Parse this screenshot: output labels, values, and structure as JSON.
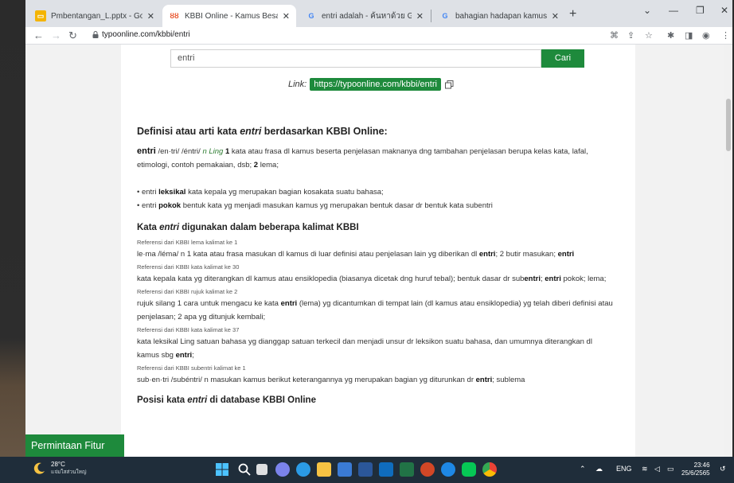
{
  "tabs": [
    {
      "title": "Pmbentangan_L.pptx - Google s",
      "active": false,
      "favicon_color": "#f4b400",
      "favicon_glyph": "▭"
    },
    {
      "title": "KBBI Online - Kamus Besar Baha",
      "active": true,
      "favicon_color": "#e8552d",
      "favicon_glyph": "ȣȣ"
    },
    {
      "title": "entri adalah - ค้นหาด้วย Google",
      "active": false,
      "favicon_color": "#4285f4",
      "favicon_glyph": "G"
    },
    {
      "title": "bahagian hadapan kamus dewan",
      "active": false,
      "favicon_color": "#4285f4",
      "favicon_glyph": "G"
    }
  ],
  "address": {
    "url": "typoonline.com/kbbi/entri"
  },
  "search": {
    "value": "entri",
    "button_label": "Cari"
  },
  "link": {
    "label": "Link:",
    "url": "https://typoonline.com/kbbi/entri"
  },
  "definition": {
    "heading_pre": "Definisi atau arti kata ",
    "heading_word": "entri",
    "heading_post": " berdasarkan KBBI Online:",
    "entry_word": "entri",
    "entry_pron": " /en·tri/ /éntri/ ",
    "entry_class": "n Ling",
    "entry_num1": " 1",
    "entry_text1": " kata atau frasa dl kamus beserta penjelasan maknanya dng tambahan penjelasan berupa kelas kata, lafal, etimologi, contoh pemakaian, dsb;",
    "entry_num2": " 2",
    "entry_text2": " lema;",
    "bullet1_pre": "• entri ",
    "bullet1_bold": "leksikal",
    "bullet1_post": " kata kepala yg merupakan bagian kosakata suatu bahasa;",
    "bullet2_pre": "• entri ",
    "bullet2_bold": "pokok",
    "bullet2_post": " bentuk kata yg menjadi masukan kamus yg merupakan bentuk dasar dr bentuk kata subentri"
  },
  "usage": {
    "heading_pre": "Kata ",
    "heading_word": "entri",
    "heading_post": " digunakan dalam beberapa kalimat KBBI",
    "items": [
      {
        "ref": "Referensi dari KBBI lema kalimat ke 1",
        "pre": "le·ma /léma/ n 1 kata atau frasa masukan dl kamus di luar definisi atau penjelasan lain yg diberikan dl ",
        "bold": "entri",
        "post": "; 2 butir masukan; ",
        "bold2": "entri",
        "post2": ""
      },
      {
        "ref": "Referensi dari KBBI kata kalimat ke 30",
        "pre": "kata kepala kata yg diterangkan dl kamus atau ensiklopedia (biasanya dicetak dng huruf tebal); bentuk dasar dr sub",
        "bold": "entri",
        "post": "; ",
        "bold2": "entri",
        "post2": " pokok; lema;"
      },
      {
        "ref": "Referensi dari KBBI rujuk kalimat ke 2",
        "pre": "rujuk silang 1 cara untuk mengacu ke kata ",
        "bold": "entri",
        "post": " (lema) yg dicantumkan di tempat lain (dl kamus atau ensiklopedia) yg telah diberi definisi atau penjelasan; 2 apa yg ditunjuk kembali;",
        "bold2": "",
        "post2": ""
      },
      {
        "ref": "Referensi dari KBBI kata kalimat ke 37",
        "pre": "kata leksikal Ling satuan bahasa yg dianggap satuan terkecil dan menjadi unsur dr leksikon suatu bahasa, dan umumnya diterangkan dl kamus sbg ",
        "bold": "entri",
        "post": ";",
        "bold2": "",
        "post2": ""
      },
      {
        "ref": "Referensi dari KBBI subentri kalimat ke 1",
        "pre": "sub·en·tri /subéntri/ n masukan kamus berikut keterangannya yg merupakan bagian yg diturunkan dr ",
        "bold": "entri",
        "post": "; sublema",
        "bold2": "",
        "post2": ""
      }
    ]
  },
  "next_heading": {
    "pre": "Posisi kata ",
    "word": "entri",
    "post": " di database KBBI Online"
  },
  "feature_button": "Permintaan Fitur",
  "taskbar": {
    "temp": "28°C",
    "weather_desc": "แจ่มใสส่วนใหญ่",
    "lang": "ENG",
    "time": "23:46",
    "date": "25/6/2565"
  },
  "colors": {
    "accent_green": "#1e8a3c"
  }
}
